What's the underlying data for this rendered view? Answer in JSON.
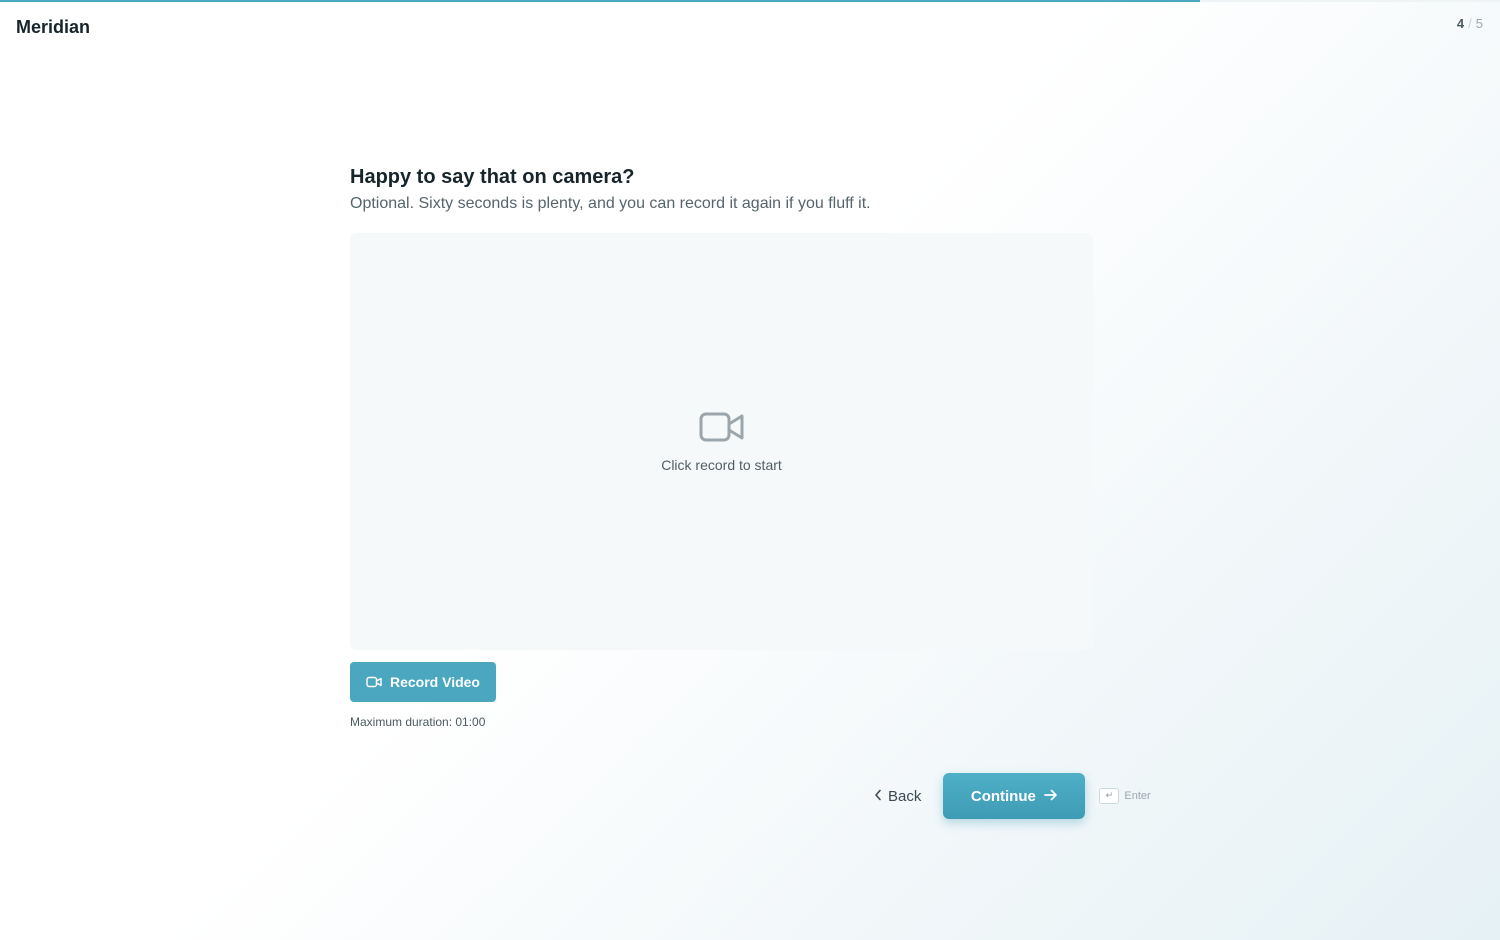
{
  "app": {
    "name": "Meridian"
  },
  "progress": {
    "current": 4,
    "total": 5,
    "separator": "/",
    "fraction": 0.8
  },
  "question": {
    "title": "Happy to say that on camera?",
    "subtitle": "Optional. Sixty seconds is plenty, and you can record it again if you fluff it."
  },
  "video": {
    "icon": "video-camera-icon",
    "placeholder": "Click record to start"
  },
  "record": {
    "label": "Record Video",
    "icon": "video-camera-icon",
    "max_duration": "Maximum duration: 01:00"
  },
  "navigation": {
    "back_label": "Back",
    "continue_label": "Continue",
    "enter_key_glyph": "↵",
    "enter_hint": "Enter"
  },
  "colors": {
    "accent": "#4aa7bf",
    "progress": "#4aa8c0",
    "text_primary": "#16252c",
    "text_muted": "#55656c"
  }
}
